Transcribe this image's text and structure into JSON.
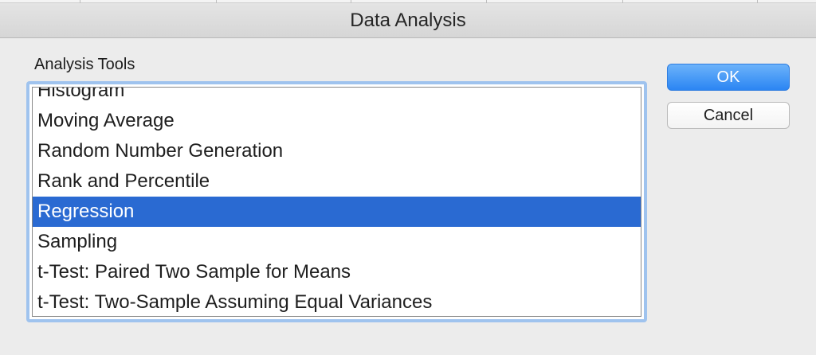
{
  "window": {
    "title": "Data Analysis"
  },
  "analysis_tools": {
    "label": "Analysis Tools",
    "selected_index": 4,
    "items": [
      "Histogram",
      "Moving Average",
      "Random Number Generation",
      "Rank and Percentile",
      "Regression",
      "Sampling",
      "t-Test: Paired Two Sample for Means",
      "t-Test: Two-Sample Assuming Equal Variances"
    ]
  },
  "buttons": {
    "ok_label": "OK",
    "cancel_label": "Cancel"
  },
  "colors": {
    "selection": "#2a6ad2",
    "focus_ring": "#9fc3ee",
    "ok_button": "#2b85f3"
  }
}
